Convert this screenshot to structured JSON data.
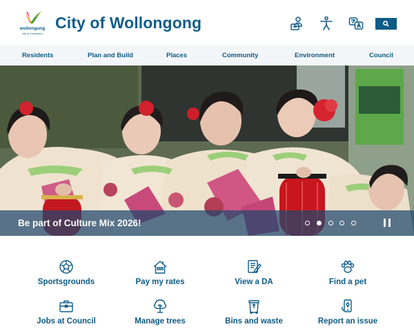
{
  "header": {
    "logo_word": "wollongong",
    "logo_tagline": "city of innovation",
    "title": "City of Wollongong",
    "icons": [
      "profile-login-icon",
      "accessibility-icon",
      "translate-icon",
      "search-icon"
    ]
  },
  "nav": {
    "items": [
      {
        "label": "Residents"
      },
      {
        "label": "Plan and Build"
      },
      {
        "label": "Places"
      },
      {
        "label": "Community"
      },
      {
        "label": "Environment"
      },
      {
        "label": "Council"
      }
    ]
  },
  "hero": {
    "caption": "Be part of Culture Mix 2026!",
    "slides_total": 5,
    "active_slide": 2
  },
  "quick_links": [
    {
      "label": "Sportsgrounds",
      "icon": "soccer-ball-icon"
    },
    {
      "label": "Pay my rates",
      "icon": "house-icon"
    },
    {
      "label": "View a DA",
      "icon": "document-pen-icon"
    },
    {
      "label": "Find a pet",
      "icon": "paw-icon"
    },
    {
      "label": "Jobs at Council",
      "icon": "briefcase-icon"
    },
    {
      "label": "Manage trees",
      "icon": "tree-icon"
    },
    {
      "label": "Bins and waste",
      "icon": "bin-icon"
    },
    {
      "label": "Report an issue",
      "icon": "report-phone-icon"
    }
  ],
  "colors": {
    "brand_blue": "#0d5b86",
    "nav_bg": "#f3f6f9",
    "logo_green": "#7ab648",
    "logo_orange": "#f08c1e"
  }
}
